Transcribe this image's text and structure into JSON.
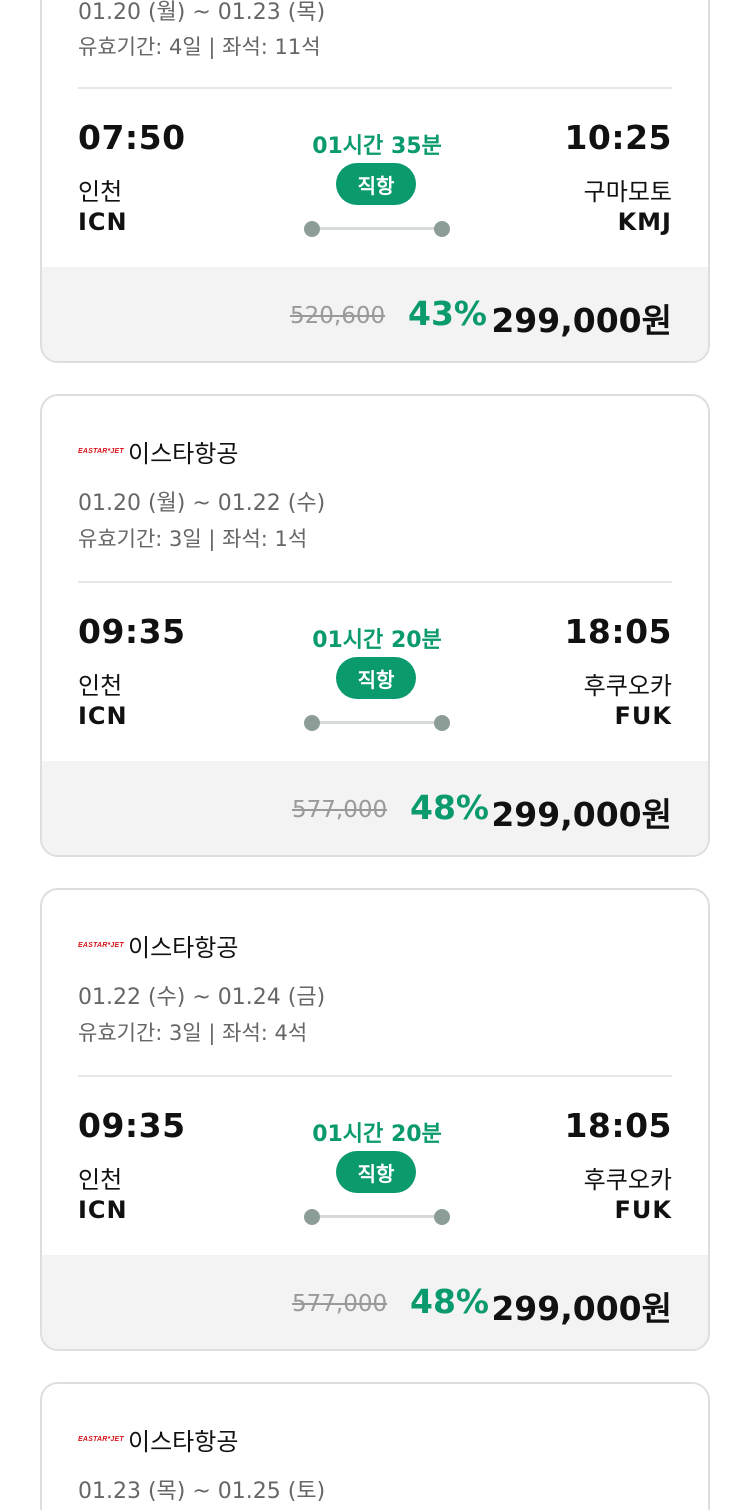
{
  "colors": {
    "accent": "#0a9a6e",
    "logo": "#d8121a",
    "card_border": "#dedede",
    "price_bg": "#f3f3f3"
  },
  "cards": [
    {
      "dates": "01.20 (월) ~ 01.23 (목)",
      "meta": "유효기간: 4일 | 좌석: 11석",
      "dep_time": "07:50",
      "dep_city": "인천",
      "dep_code": "ICN",
      "duration": "01시간 35분",
      "badge": "직항",
      "arr_time": "10:25",
      "arr_city": "구마모토",
      "arr_code": "KMJ",
      "orig_price": "520,600",
      "discount": "43%",
      "final_price": "299,000원"
    },
    {
      "logo": "EASTAR*JET",
      "airline": "이스타항공",
      "dates": "01.20 (월) ~ 01.22 (수)",
      "meta": "유효기간: 3일 | 좌석: 1석",
      "dep_time": "09:35",
      "dep_city": "인천",
      "dep_code": "ICN",
      "duration": "01시간 20분",
      "badge": "직항",
      "arr_time": "18:05",
      "arr_city": "후쿠오카",
      "arr_code": "FUK",
      "orig_price": "577,000",
      "discount": "48%",
      "final_price": "299,000원"
    },
    {
      "logo": "EASTAR*JET",
      "airline": "이스타항공",
      "dates": "01.22 (수) ~ 01.24 (금)",
      "meta": "유효기간: 3일 | 좌석: 4석",
      "dep_time": "09:35",
      "dep_city": "인천",
      "dep_code": "ICN",
      "duration": "01시간 20분",
      "badge": "직항",
      "arr_time": "18:05",
      "arr_city": "후쿠오카",
      "arr_code": "FUK",
      "orig_price": "577,000",
      "discount": "48%",
      "final_price": "299,000원"
    },
    {
      "logo": "EASTAR*JET",
      "airline": "이스타항공",
      "dates": "01.23 (목) ~ 01.25 (토)"
    }
  ]
}
